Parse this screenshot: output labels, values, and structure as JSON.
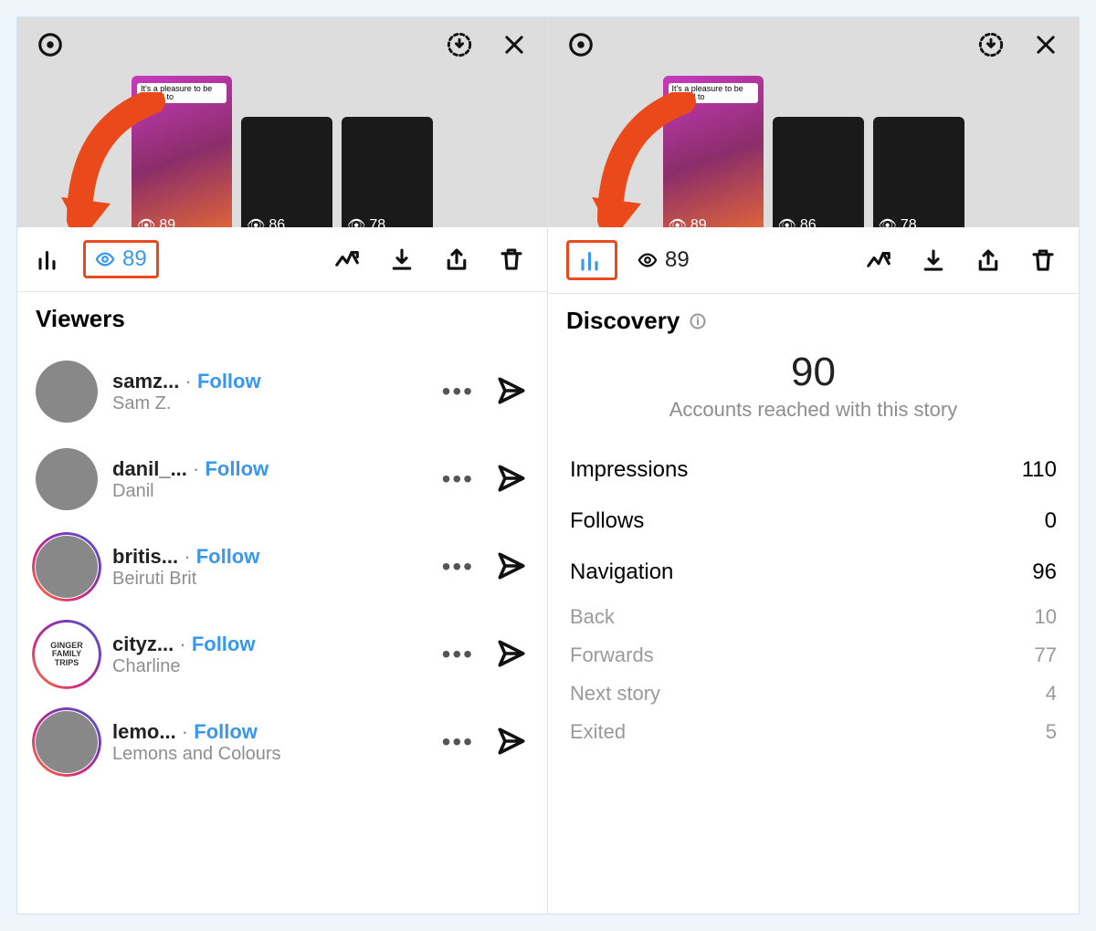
{
  "header": {
    "stories": [
      {
        "views": "89",
        "caption": "It's a pleasure to be invited to",
        "active": true
      },
      {
        "views": "86",
        "caption": "",
        "active": false
      },
      {
        "views": "78",
        "caption": "",
        "active": false
      }
    ]
  },
  "tabs": {
    "views_count": "89"
  },
  "viewers": {
    "title": "Viewers",
    "follow_label": "Follow",
    "list": [
      {
        "username": "samz...",
        "display": "Sam Z.",
        "ring": false
      },
      {
        "username": "danil_...",
        "display": "Danil",
        "ring": false
      },
      {
        "username": "britis...",
        "display": "Beiruti Brit",
        "ring": true
      },
      {
        "username": "cityz...",
        "display": "Charline",
        "ring": true,
        "avatar_text": "GINGER FAMILY TRIPS"
      },
      {
        "username": "lemo...",
        "display": "Lemons and Colours",
        "ring": true
      }
    ]
  },
  "discovery": {
    "title": "Discovery",
    "reached_value": "90",
    "reached_label": "Accounts reached with this story",
    "rows": [
      {
        "label": "Impressions",
        "value": "110",
        "sub": false
      },
      {
        "label": "Follows",
        "value": "0",
        "sub": false
      },
      {
        "label": "Navigation",
        "value": "96",
        "sub": false
      },
      {
        "label": "Back",
        "value": "10",
        "sub": true
      },
      {
        "label": "Forwards",
        "value": "77",
        "sub": true
      },
      {
        "label": "Next story",
        "value": "4",
        "sub": true
      },
      {
        "label": "Exited",
        "value": "5",
        "sub": true
      }
    ]
  },
  "colors": {
    "accent": "#3897f0",
    "highlight": "#ea4a1b"
  }
}
